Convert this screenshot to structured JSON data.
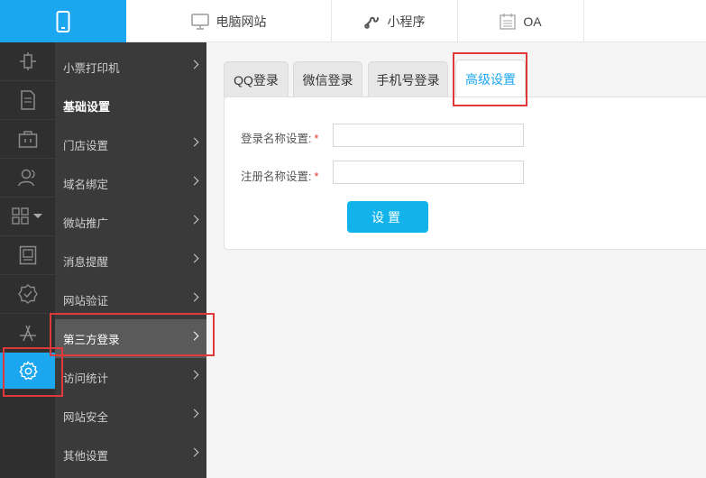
{
  "top_nav": {
    "tabs": [
      {
        "label": "电脑网站",
        "icon": "monitor-icon"
      },
      {
        "label": "小程序",
        "icon": "mini-program-icon"
      },
      {
        "label": "OA",
        "icon": "calendar-icon"
      }
    ],
    "active_icon": "phone-icon"
  },
  "icon_sidebar": {
    "items": [
      "plugin-icon",
      "document-icon",
      "briefcase-icon",
      "users-icon",
      "grid-icon",
      "picture-frame-icon",
      "badge-check-icon",
      "app-store-icon",
      "gear-icon"
    ],
    "active": "gear-icon"
  },
  "submenu": {
    "items": [
      {
        "label": "小票打印机"
      },
      {
        "label": "基础设置"
      },
      {
        "label": "门店设置"
      },
      {
        "label": "域名绑定"
      },
      {
        "label": "微站推广"
      },
      {
        "label": "消息提醒"
      },
      {
        "label": "网站验证"
      },
      {
        "label": "第三方登录"
      },
      {
        "label": "访问统计"
      },
      {
        "label": "网站安全"
      },
      {
        "label": "其他设置"
      }
    ],
    "active": "第三方登录"
  },
  "content": {
    "tabs": [
      {
        "label": "QQ登录"
      },
      {
        "label": "微信登录"
      },
      {
        "label": "手机号登录"
      },
      {
        "label": "高级设置"
      }
    ],
    "active_tab": "高级设置",
    "form": {
      "login_name_label": "登录名称设置:",
      "login_name_value": "",
      "register_name_label": "注册名称设置:",
      "register_name_value": "",
      "required_mark": "*",
      "submit_label": "设置"
    }
  },
  "colors": {
    "accent": "#1aa7ef",
    "sidebar_dark": "#2f2f2f",
    "submenu_bg": "#3a3a3a",
    "highlight": "#e0393b"
  }
}
